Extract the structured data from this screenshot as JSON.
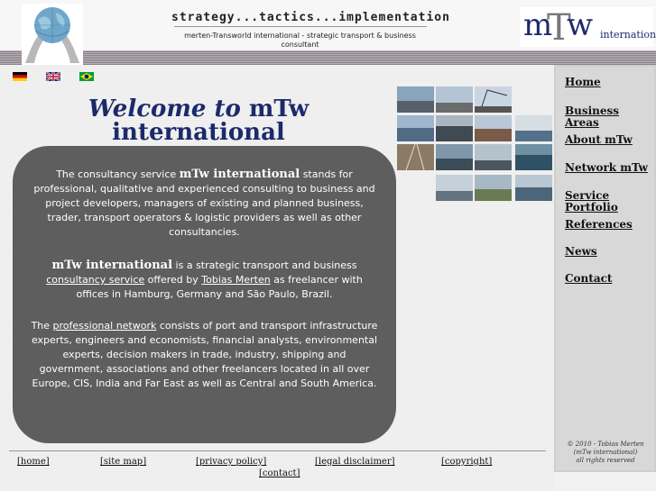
{
  "header": {
    "tagline": "strategy...tactics...implementation",
    "subline": "merten-Transworld international - strategic transport & business consultant",
    "logo": {
      "m": "m",
      "t": "T",
      "w": "w",
      "international": "international"
    }
  },
  "flags": [
    {
      "name": "german-flag-icon",
      "colors": [
        "#000000",
        "#dd0000",
        "#ffce00"
      ]
    },
    {
      "name": "uk-flag-icon",
      "colors": [
        "#012169",
        "#ffffff",
        "#c8102e"
      ]
    },
    {
      "name": "brazil-flag-icon",
      "colors": [
        "#009c3b",
        "#ffdf00",
        "#002776"
      ]
    }
  ],
  "welcome": {
    "italic": "Welcome to",
    "rest": " mTw",
    "line2": "international"
  },
  "panel": {
    "p1_pre": "The consultancy service ",
    "p1_bold": "mTw international",
    "p1_post": " stands for professional, qualitative and experienced consulting to business and project developers, managers of existing and planned business, trader, transport operators & logistic providers as well as other consultancies.",
    "p2_bold": "mTw international",
    "p2_a": " is a strategic transport and business ",
    "p2_link1": "consultancy service",
    "p2_b": " offered by ",
    "p2_link2": "Tobias Merten",
    "p2_c": " as freelancer with offices in Hamburg, Germany and São Paulo, Brazil.",
    "p3_a": "The ",
    "p3_link": "professional network",
    "p3_b": " consists of port and transport infrastructure experts, engineers and economists, financial analysts, environmental experts, decision makers in trade, industry, shipping and government, associations and other freelancers located in all over Europe, CIS, India and Far East as well as Central and South America."
  },
  "nav": [
    "Home",
    "Business Areas",
    "About mTw",
    "Network mTw",
    "Service Portfolio",
    "References",
    "News",
    "Contact"
  ],
  "footer": [
    "[home]",
    "[site map]",
    "[privacy policy]",
    "[legal disclaimer]",
    "[copyright]",
    "[contact]"
  ],
  "copyright": {
    "line1": "© 2010 - Tobias Merten",
    "line2": "(mTw international)",
    "line3": "all rights reserved"
  },
  "colors": {
    "brand_navy": "#1c2a6b",
    "panel": "#5e5e5e",
    "sidebar": "#d8d8d8"
  }
}
